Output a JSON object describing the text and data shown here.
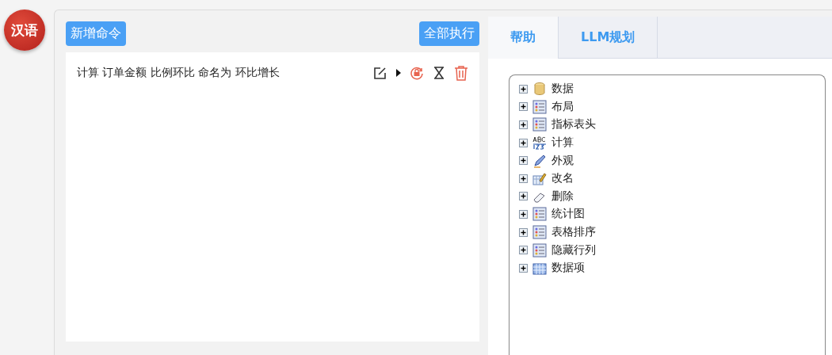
{
  "language_badge": "汉语",
  "toolbar": {
    "add_button": "新增命令",
    "run_all_button": "全部执行"
  },
  "commands": [
    {
      "text": "计算 订单金额 比例环比 命名为 环比增长"
    }
  ],
  "tabs": [
    {
      "label": "帮助",
      "selected": true
    },
    {
      "label": "LLM规划",
      "selected": false
    }
  ],
  "tree": [
    {
      "label": "数据",
      "kind": "database",
      "expanded": false
    },
    {
      "label": "布局",
      "kind": "list",
      "expanded": false
    },
    {
      "label": "指标表头",
      "kind": "list",
      "expanded": false
    },
    {
      "label": "计算",
      "kind": "abc",
      "expanded": false
    },
    {
      "label": "外观",
      "kind": "pen",
      "expanded": false
    },
    {
      "label": "改名",
      "kind": "rename",
      "expanded": false
    },
    {
      "label": "删除",
      "kind": "eraser",
      "expanded": false
    },
    {
      "label": "统计图",
      "kind": "list",
      "expanded": false
    },
    {
      "label": "表格排序",
      "kind": "list",
      "expanded": false
    },
    {
      "label": "隐藏行列",
      "kind": "list",
      "expanded": false
    },
    {
      "label": "数据项",
      "kind": "grid",
      "expanded": false
    }
  ]
}
